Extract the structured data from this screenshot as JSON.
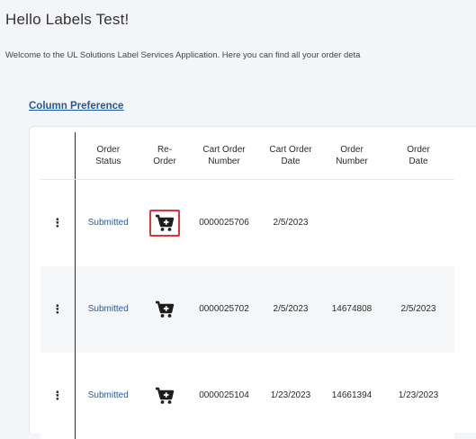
{
  "header": {
    "greeting": "Hello Labels Test!",
    "welcome": "Welcome to the UL Solutions Label Services Application. Here you can find all your order deta"
  },
  "column_preference_label": "Column Preference",
  "table": {
    "columns": [
      "",
      "Order Status",
      "Re-Order",
      "Cart Order Number",
      "Cart Order Date",
      "Order Number",
      "Order Date"
    ],
    "rows": [
      {
        "menu": "⋮",
        "status": "Submitted",
        "reorder_icon": "cart-plus-icon",
        "cart_order_number": "0000025706",
        "cart_order_date": "2/5/2023",
        "order_number": "",
        "order_date": ""
      },
      {
        "menu": "⋮",
        "status": "Submitted",
        "reorder_icon": "cart-plus-icon",
        "cart_order_number": "0000025702",
        "cart_order_date": "2/5/2023",
        "order_number": "14674808",
        "order_date": "2/5/2023"
      },
      {
        "menu": "⋮",
        "status": "Submitted",
        "reorder_icon": "cart-plus-icon",
        "cart_order_number": "0000025104",
        "cart_order_date": "1/23/2023",
        "order_number": "14661394",
        "order_date": "1/23/2023"
      }
    ]
  },
  "colors": {
    "link": "#1f5aa6",
    "highlight_border": "#d9363e"
  }
}
